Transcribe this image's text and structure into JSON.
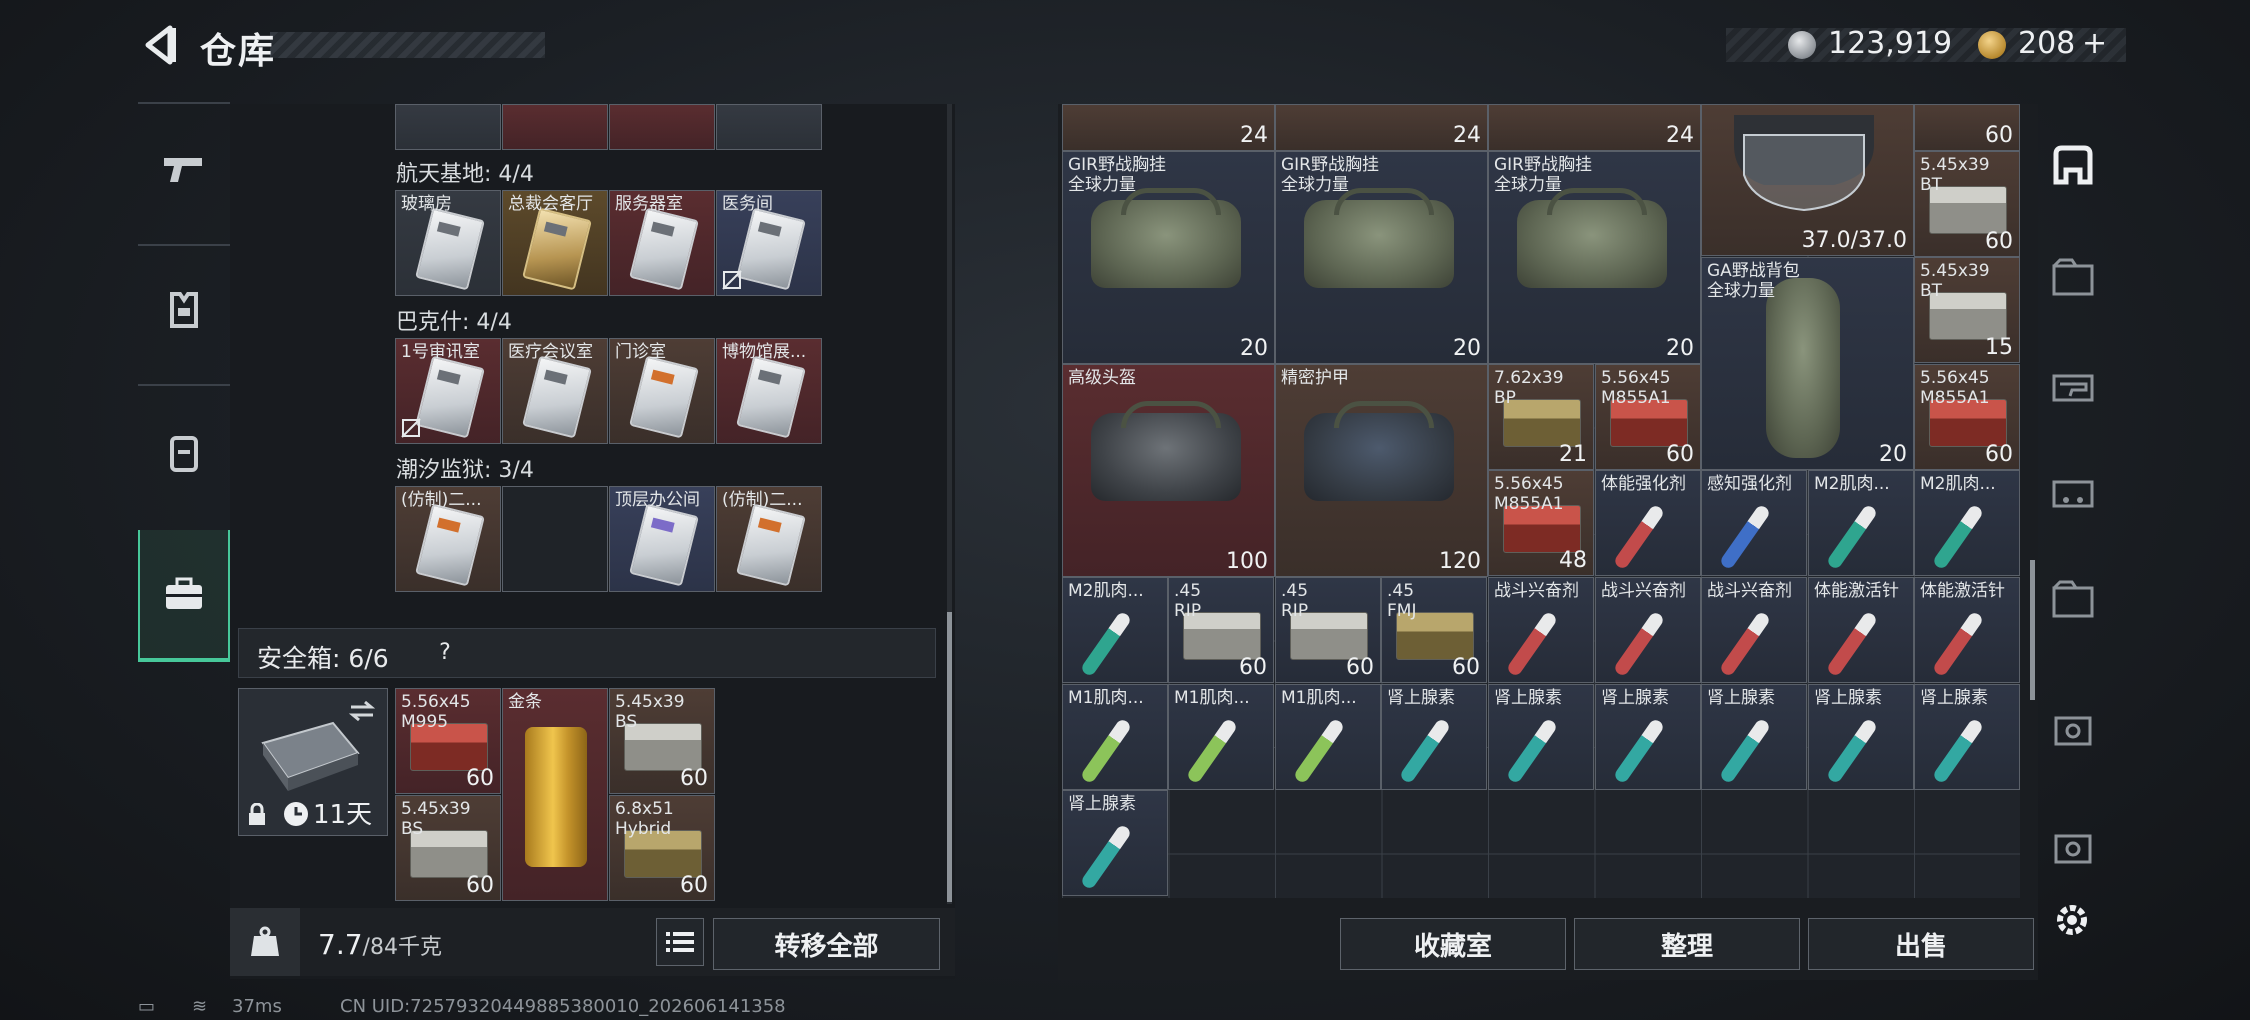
{
  "header": {
    "title": "仓库",
    "currency_silver": "123,919",
    "currency_gold": "208",
    "gold_plus": "+"
  },
  "left": {
    "sections": [
      {
        "label": "航天基地: 4/4",
        "items": [
          "玻璃房",
          "总裁会客厅",
          "服务器室",
          "医务间"
        ]
      },
      {
        "label": "巴克什: 4/4",
        "items": [
          "1号审讯室",
          "医疗会议室",
          "门诊室",
          "博物馆展..."
        ]
      },
      {
        "label": "潮汐监狱: 3/4",
        "items": [
          "(仿制)二...",
          "",
          "顶层办公间",
          "(仿制)二..."
        ]
      }
    ],
    "safe": {
      "label": "安全箱: 6/6",
      "help": "?",
      "days": "11天",
      "items": [
        {
          "name": "5.56x45\nM995",
          "count": "60"
        },
        {
          "name": "金条",
          "count": ""
        },
        {
          "name": "5.45x39\nBS",
          "count": "60"
        },
        {
          "name": "5.45x39\nBS",
          "count": "60"
        },
        {
          "name": "6.8x51\nHybrid",
          "count": "60"
        }
      ]
    },
    "weight": "7.7",
    "weight_max": "/84千克",
    "transfer_all": "转移全部"
  },
  "right": {
    "top_counts": [
      "24",
      "24",
      "24",
      "60"
    ],
    "vests": [
      {
        "name": "GIR野战胸挂\n全球力量",
        "count": "20"
      },
      {
        "name": "GIR野战胸挂\n全球力量",
        "count": "20"
      },
      {
        "name": "GIR野战胸挂\n全球力量",
        "count": "20"
      }
    ],
    "helmet_durability": "37.0/37.0",
    "ammo_r1": {
      "name": "5.45x39\nBT",
      "count": "60"
    },
    "ammo_r2": {
      "name": "5.45x39\nBT",
      "count": "15"
    },
    "backpack": {
      "name": "GA野战背包\n全球力量",
      "count": "20"
    },
    "bag1": {
      "name": "高级头盔",
      "count": "100"
    },
    "bag2": {
      "name": "精密护甲",
      "count": "120"
    },
    "row3": [
      {
        "name": "7.62x39\nBP",
        "count": "21"
      },
      {
        "name": "5.56x45\nM855A1",
        "count": "60"
      }
    ],
    "ammo_r3": {
      "name": "5.56x45\nM855A1",
      "count": "60"
    },
    "row4": [
      {
        "name": "5.56x45\nM855A1",
        "count": "48"
      },
      {
        "name": "体能强化剂",
        "count": ""
      },
      {
        "name": "感知强化剂",
        "count": ""
      },
      {
        "name": "M2肌肉...",
        "count": ""
      },
      {
        "name": "M2肌肉...",
        "count": ""
      }
    ],
    "row5": [
      {
        "name": "M2肌肉...",
        "count": ""
      },
      {
        "name": ".45\nRIP",
        "count": "60"
      },
      {
        "name": ".45\nRIP",
        "count": "60"
      },
      {
        "name": ".45\nFMJ",
        "count": "60"
      },
      {
        "name": "战斗兴奋剂",
        "count": ""
      },
      {
        "name": "战斗兴奋剂",
        "count": ""
      },
      {
        "name": "战斗兴奋剂",
        "count": ""
      },
      {
        "name": "体能激活针",
        "count": ""
      },
      {
        "name": "体能激活针",
        "count": ""
      }
    ],
    "row6": [
      {
        "name": "M1肌肉...",
        "count": ""
      },
      {
        "name": "M1肌肉...",
        "count": ""
      },
      {
        "name": "M1肌肉...",
        "count": ""
      },
      {
        "name": "肾上腺素",
        "count": ""
      },
      {
        "name": "肾上腺素",
        "count": ""
      },
      {
        "name": "肾上腺素",
        "count": ""
      },
      {
        "name": "肾上腺素",
        "count": ""
      },
      {
        "name": "肾上腺素",
        "count": ""
      },
      {
        "name": "肾上腺素",
        "count": ""
      }
    ],
    "row7": [
      {
        "name": "肾上腺素",
        "count": ""
      }
    ],
    "buttons": {
      "collection": "收藏室",
      "sort": "整理",
      "sell": "出售"
    }
  },
  "status": {
    "ping": "37ms",
    "uid": "CN UID:7257932044988538001​0_202606141358"
  }
}
